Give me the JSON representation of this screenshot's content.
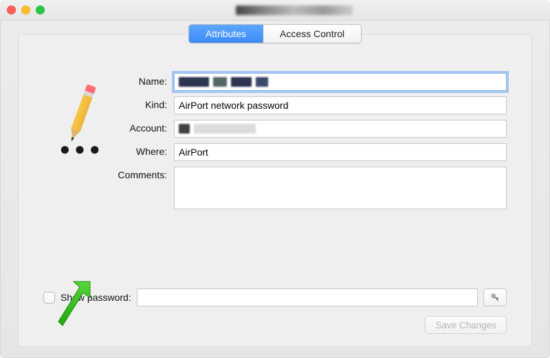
{
  "tabs": {
    "attributes": "Attributes",
    "access_control": "Access Control",
    "selected": "attributes"
  },
  "labels": {
    "name": "Name:",
    "kind": "Kind:",
    "account": "Account:",
    "where": "Where:",
    "comments": "Comments:",
    "show_password": "Show password:",
    "save": "Save Changes"
  },
  "values": {
    "name": "",
    "kind": "AirPort network password",
    "account": "",
    "where": "AirPort",
    "comments": "",
    "password": ""
  },
  "state": {
    "show_password_checked": false,
    "save_enabled": false
  }
}
